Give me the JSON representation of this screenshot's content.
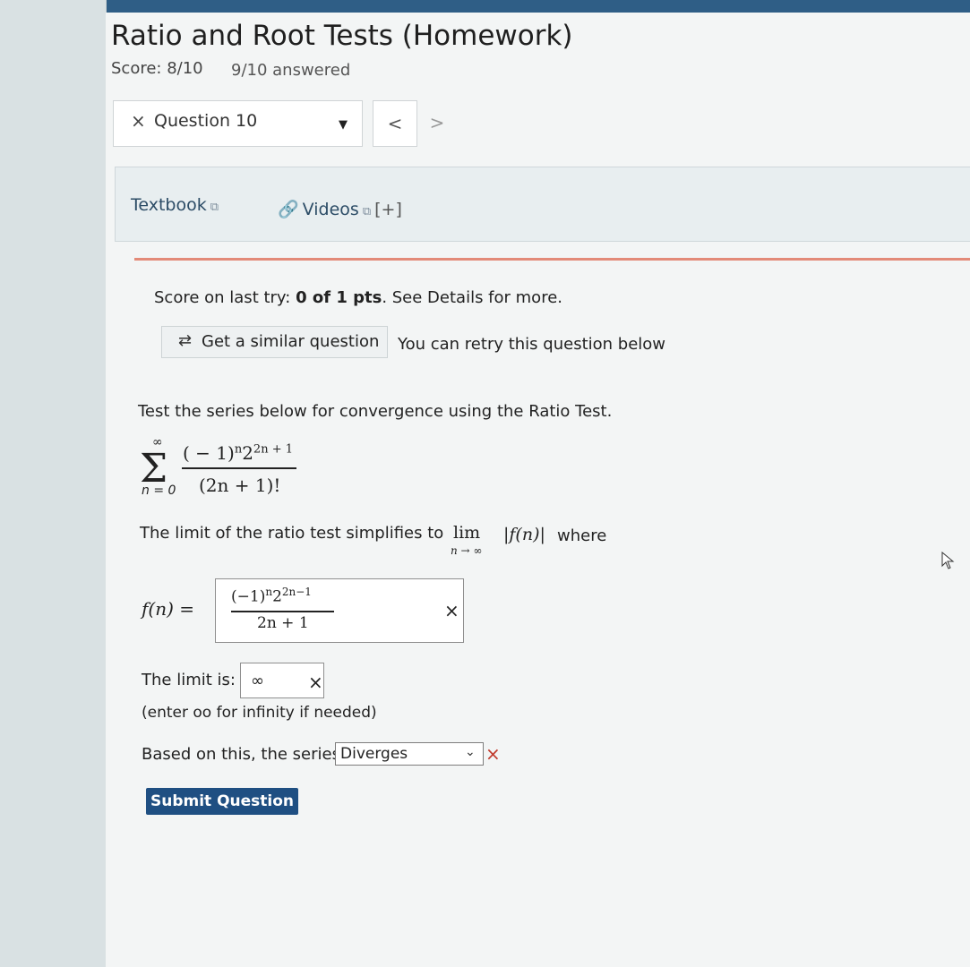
{
  "header": {
    "title": "Ratio and Root Tests (Homework)",
    "score": "Score: 8/10",
    "answered": "9/10 answered"
  },
  "question_nav": {
    "status_icon": "×",
    "label": "Question 10",
    "caret": "▼",
    "prev": "<",
    "next": ">"
  },
  "resources": {
    "textbook": "Textbook",
    "videos": "Videos",
    "videos_more": "[+]",
    "external_icon": "⧉"
  },
  "feedback": {
    "last_try_prefix": "Score on last try: ",
    "last_try_score": "0 of 1 pts",
    "last_try_suffix": ". See Details for more.",
    "similar_button": "Get a similar question",
    "retry_text": "You can retry this question below"
  },
  "problem": {
    "prompt": "Test the series below for convergence using the Ratio Test.",
    "sum_upper": "∞",
    "sum_lower": "n = 0",
    "numerator_base": "( − 1)",
    "numerator_exp1": "n",
    "numerator_mid": "2",
    "numerator_exp2": "2n + 1",
    "denominator": "(2n + 1)!",
    "limit_prefix": "The limit of the ratio test simplifies to",
    "lim": "lim",
    "lim_sub": "n → ∞",
    "abs_fn": "|f(n)|",
    "where": "where"
  },
  "answers": {
    "fn_label": "f(n) =",
    "fn_num_base": "(−1)",
    "fn_num_exp1": "n",
    "fn_num_mid": "2",
    "fn_num_exp2": "2n−1",
    "fn_den": "2n + 1",
    "fn_mark": "×",
    "limit_label": "The limit is:",
    "limit_value": "∞",
    "limit_mark": "×",
    "limit_hint": "(enter oo for infinity if needed)",
    "series_label": "Based on this, the series",
    "series_value": "Diverges",
    "series_mark": "×",
    "submit": "Submit Question"
  }
}
